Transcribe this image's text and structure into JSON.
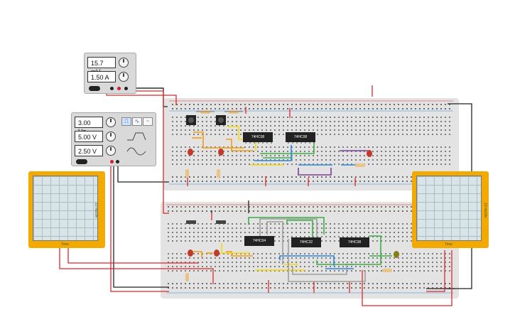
{
  "power_supply": {
    "voltage": "15.7 mV",
    "current": "1.50 A"
  },
  "function_generator": {
    "frequency": "3.00 Hz",
    "amplitude": "5.00 V",
    "dc_offset": "2.50 V",
    "waveforms": [
      "square-wave-icon",
      "triangle-wave-icon",
      "sine-wave-icon"
    ]
  },
  "oscilloscopes": {
    "left": {
      "side_label": "10 ms/div",
      "bottom_label": "Time"
    },
    "right": {
      "side_label": "10 ms/div",
      "bottom_label": "Time"
    }
  },
  "chips": {
    "top_1": "74HC08",
    "top_2": "74HC08",
    "bottom_1": "74HC04",
    "bottom_2": "74HC32",
    "bottom_3": "74HC08"
  },
  "colors": {
    "wire_red": "#e0262b",
    "wire_black": "#222222",
    "wire_orange": "#f39c12",
    "wire_yellow": "#f5d90a",
    "wire_green": "#3cb043",
    "wire_blue": "#2e86de",
    "wire_purple": "#7d3c98",
    "wire_gray": "#9e9e9e",
    "scope_body": "#f2a900",
    "led_red": "#c0392b",
    "led_olive": "#8a7d16"
  }
}
